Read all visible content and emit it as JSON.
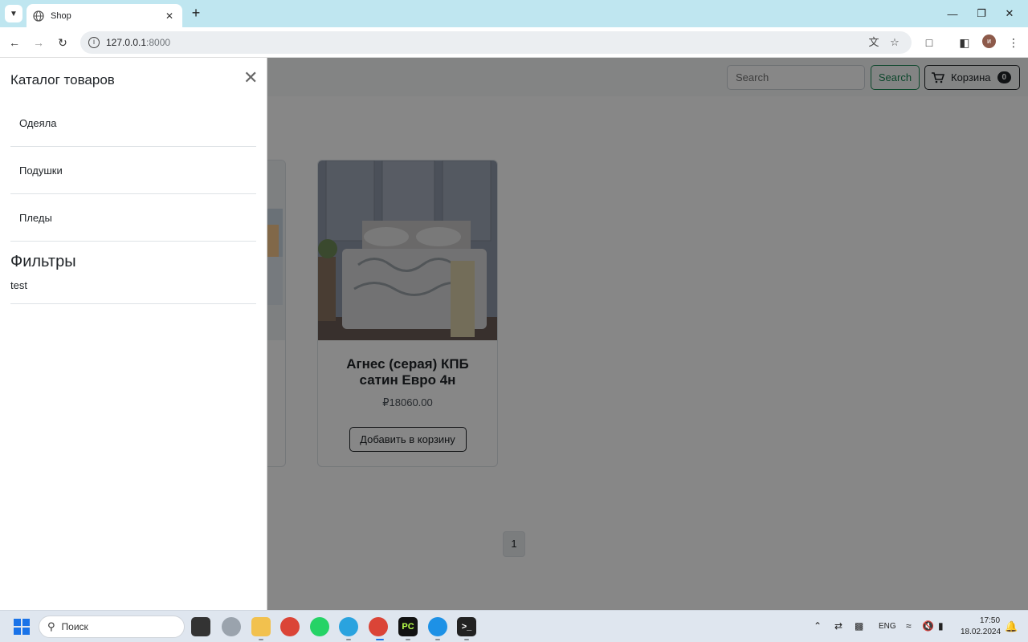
{
  "browser": {
    "tab_title": "Shop",
    "url_host": "127.0.0.1",
    "url_port": ":8000"
  },
  "navbar": {
    "search_placeholder": "Search",
    "search_button": "Search",
    "cart_label": "Корзина",
    "cart_count": "0"
  },
  "product": {
    "title": "Агнес (серая) КПБ сатин Евро 4н",
    "price": "₽18060.00",
    "add_button": "Добавить в корзину"
  },
  "pagination": {
    "current": "1"
  },
  "offcanvas": {
    "title": "Каталог товаров",
    "categories": [
      {
        "label": "Одеяла"
      },
      {
        "label": "Подушки"
      },
      {
        "label": "Пледы"
      }
    ],
    "filters_title": "Фильтры",
    "filters": [
      {
        "label": "test"
      }
    ]
  },
  "taskbar": {
    "search_placeholder": "Поиск",
    "lang": "ENG",
    "time": "17:50",
    "date": "18.02.2024"
  },
  "colors": {
    "tabstrip": "#bfe6f0",
    "success": "#198754",
    "dark": "#212529"
  }
}
